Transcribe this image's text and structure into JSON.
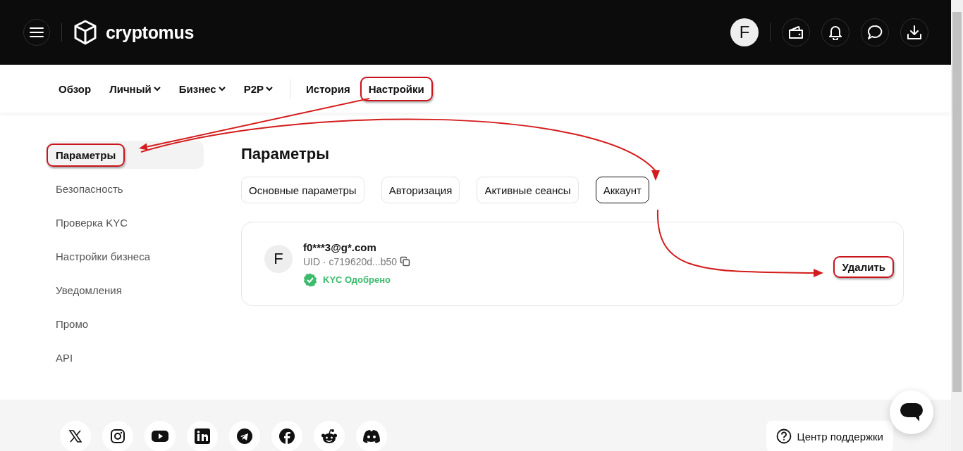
{
  "header": {
    "logo": "cryptomus",
    "avatar": "F"
  },
  "nav": [
    {
      "label": "Обзор",
      "dropdown": false,
      "annotated": false
    },
    {
      "label": "Личный",
      "dropdown": true,
      "annotated": false
    },
    {
      "label": "Бизнес",
      "dropdown": true,
      "annotated": false
    },
    {
      "label": "P2P",
      "dropdown": true,
      "annotated": false
    },
    {
      "label": "История",
      "dropdown": false,
      "annotated": false
    },
    {
      "label": "Настройки",
      "dropdown": false,
      "annotated": true
    }
  ],
  "sidebar": [
    {
      "label": "Параметры",
      "selected": true,
      "annotated": true
    },
    {
      "label": "Безопасность",
      "selected": false,
      "annotated": false
    },
    {
      "label": "Проверка KYC",
      "selected": false,
      "annotated": false
    },
    {
      "label": "Настройки бизнеса",
      "selected": false,
      "annotated": false
    },
    {
      "label": "Уведомления",
      "selected": false,
      "annotated": false
    },
    {
      "label": "Промо",
      "selected": false,
      "annotated": false
    },
    {
      "label": "API",
      "selected": false,
      "annotated": false
    }
  ],
  "title": "Параметры",
  "tabs": [
    {
      "label": "Основные параметры",
      "selected": false
    },
    {
      "label": "Авторизация",
      "selected": false
    },
    {
      "label": "Активные сеансы",
      "selected": false
    },
    {
      "label": "Аккаунт",
      "selected": true
    }
  ],
  "account": {
    "avatar": "F",
    "email": "f0***3@g*.com",
    "uid": "UID · c719620d...b50",
    "kyc": "KYC Одобрено",
    "delete": {
      "label": "Удалить",
      "annotated": true
    }
  },
  "footer": {
    "socials": [
      {
        "kind": "x"
      },
      {
        "kind": "instagram"
      },
      {
        "kind": "youtube"
      },
      {
        "kind": "linkedin"
      },
      {
        "kind": "telegram"
      },
      {
        "kind": "facebook"
      },
      {
        "kind": "reddit"
      },
      {
        "kind": "discord"
      }
    ],
    "support": "Центр поддержки"
  }
}
